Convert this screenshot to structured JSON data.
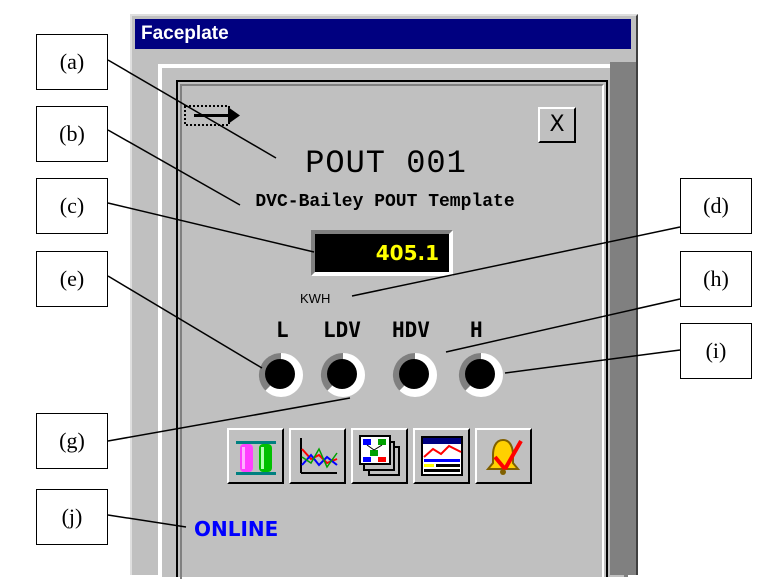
{
  "window": {
    "title": "Faceplate"
  },
  "faceplate": {
    "tag": "POUT 001",
    "description": "DVC-Bailey POUT Template",
    "value": "405.1",
    "units": "KWH",
    "close_label": "X",
    "status": "ONLINE",
    "alarm_labels": [
      "L",
      "LDV",
      "HDV",
      "H"
    ],
    "toolbar_icons": [
      "tank-display-icon",
      "trend-icon",
      "graphics-display-icon",
      "report-icon",
      "alarm-ack-icon"
    ]
  },
  "callouts": [
    "(a)",
    "(b)",
    "(c)",
    "(d)",
    "(e)",
    "(h)",
    "(i)",
    "(g)",
    "(j)"
  ],
  "colors": {
    "titlebar": "#000080",
    "value_text": "#ffff00",
    "status_text": "#0000ff",
    "panel": "#c0c0c0"
  }
}
